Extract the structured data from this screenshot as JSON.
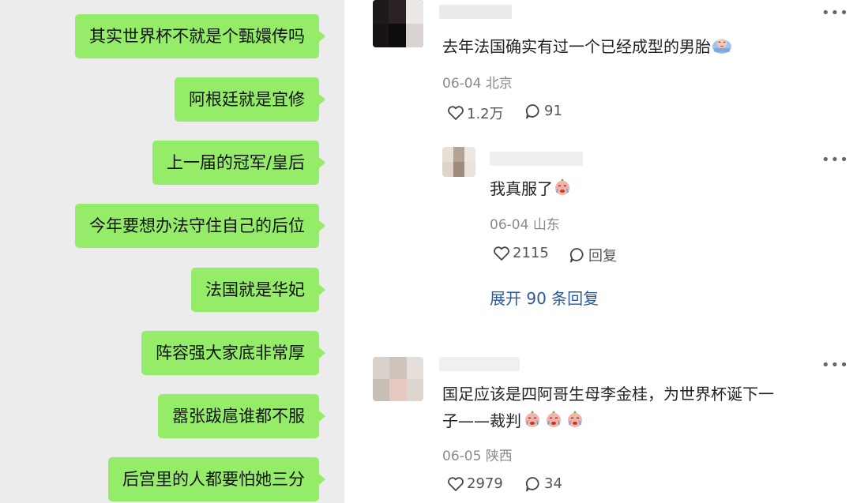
{
  "chat": {
    "messages": [
      {
        "text": "其实世界杯不就是个甄嬛传吗"
      },
      {
        "text": "阿根廷就是宜修"
      },
      {
        "text": "上一届的冠军/皇后"
      },
      {
        "text": "今年要想办法守住自己的后位"
      },
      {
        "text": "法国就是华妃"
      },
      {
        "text": "阵容强大家底非常厚"
      },
      {
        "text": "嚣张跋扈谁都不服"
      },
      {
        "text": "后宫里的人都要怕她三分"
      }
    ],
    "bubble_color": "#95ec69",
    "background_color": "#ececec"
  },
  "comments": {
    "link_color": "#2c5a9a",
    "items": [
      {
        "text": "去年法国确实有过一个已经成型的男胎",
        "emoji": "crying-baby-emoji",
        "date": "06-04",
        "location": "北京",
        "likes": "1.2万",
        "comments": "91",
        "reply": {
          "text": "我真服了",
          "emoji": "crying-emoji",
          "date": "06-04",
          "location": "山东",
          "likes": "2115",
          "reply_label": "回复"
        },
        "expand_label": "展开 90 条回复"
      },
      {
        "text_line1": "国足应该是四阿哥生母李金桂，为世界杯诞下一",
        "text_line2": "子——裁判",
        "emoji": "crying-emoji",
        "date": "06-05",
        "location": "陕西",
        "likes": "2979",
        "comments": "34"
      }
    ]
  }
}
